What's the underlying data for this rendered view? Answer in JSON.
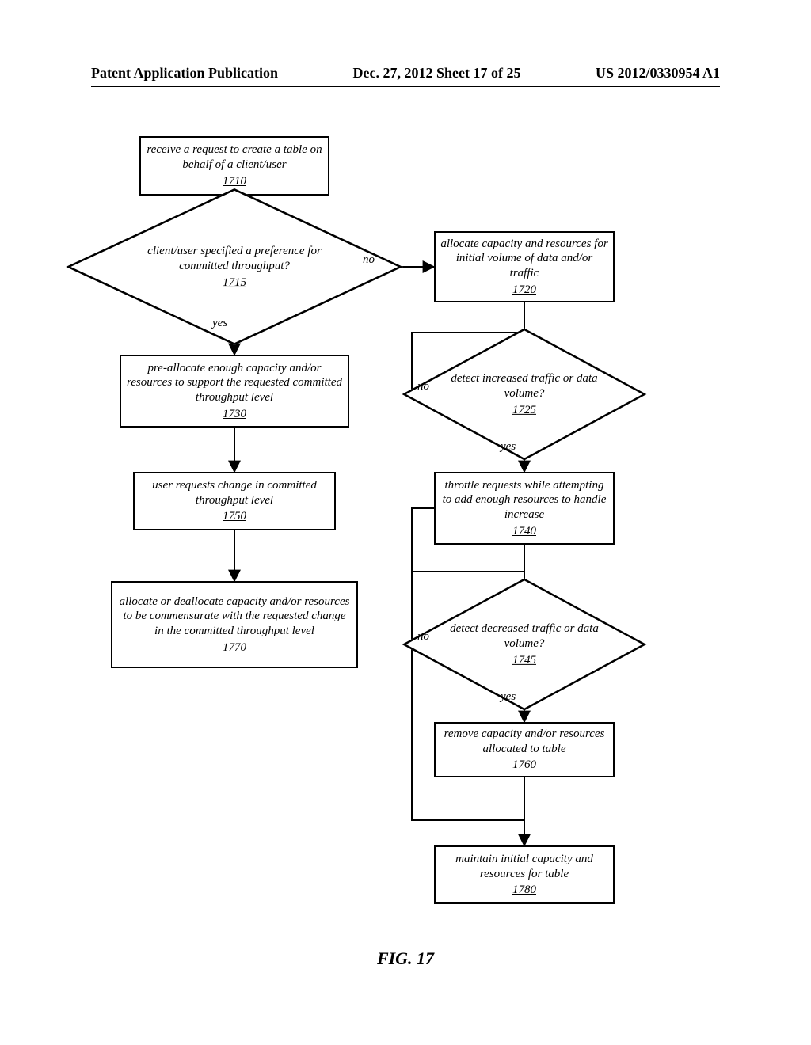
{
  "header": {
    "left": "Patent Application Publication",
    "center": "Dec. 27, 2012  Sheet 17 of 25",
    "right": "US 2012/0330954 A1"
  },
  "figure_label": "FIG. 17",
  "labels": {
    "no": "no",
    "yes": "yes"
  },
  "boxes": {
    "b1710": {
      "text": "receive a request to create a table on behalf of a client/user",
      "ref": "1710"
    },
    "d1715": {
      "text": "client/user specified a preference for committed throughput?",
      "ref": "1715"
    },
    "b1720": {
      "text": "allocate capacity and resources for initial volume of data and/or traffic",
      "ref": "1720"
    },
    "d1725": {
      "text": "detect increased traffic or data volume?",
      "ref": "1725"
    },
    "b1730": {
      "text": "pre-allocate enough capacity and/or resources to support the requested committed throughput level",
      "ref": "1730"
    },
    "b1740": {
      "text": "throttle requests while attempting to add enough resources to handle increase",
      "ref": "1740"
    },
    "d1745": {
      "text": "detect decreased traffic or data volume?",
      "ref": "1745"
    },
    "b1750": {
      "text": "user requests change in committed throughput level",
      "ref": "1750"
    },
    "b1760": {
      "text": "remove capacity and/or resources allocated to table",
      "ref": "1760"
    },
    "b1770": {
      "text": "allocate or deallocate capacity and/or resources to be commensurate with the requested change in the committed throughput level",
      "ref": "1770"
    },
    "b1780": {
      "text": "maintain initial capacity and resources for table",
      "ref": "1780"
    }
  }
}
